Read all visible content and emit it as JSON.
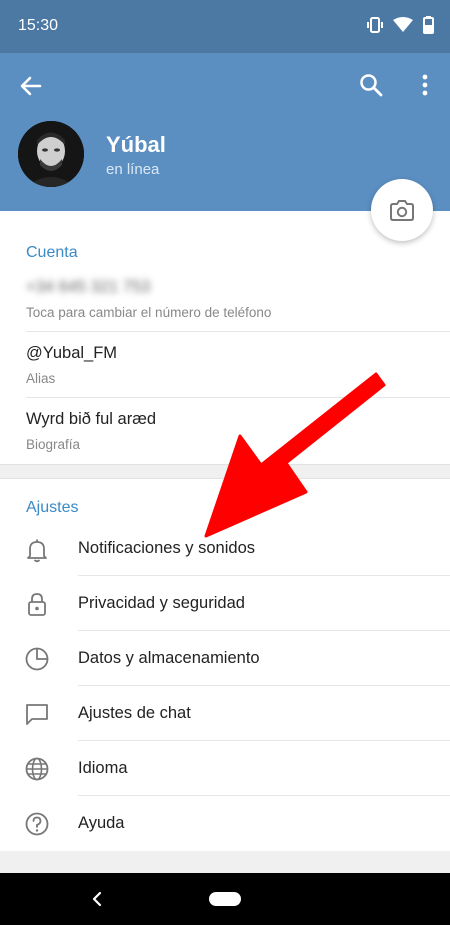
{
  "status_bar": {
    "time": "15:30",
    "icons": [
      "vibrate-icon",
      "wifi-icon",
      "battery-icon"
    ]
  },
  "profile": {
    "name": "Yúbal",
    "status": "en línea"
  },
  "account": {
    "title": "Cuenta",
    "phone": "+34 645 321 753",
    "phone_hint": "Toca para cambiar el número de teléfono",
    "alias": "@Yubal_FM",
    "alias_label": "Alias",
    "bio": "Wyrd bið ful aræd",
    "bio_label": "Biografía"
  },
  "settings": {
    "title": "Ajustes",
    "items": [
      {
        "label": "Notificaciones y sonidos",
        "icon": "bell-icon"
      },
      {
        "label": "Privacidad y seguridad",
        "icon": "lock-icon"
      },
      {
        "label": "Datos y almacenamiento",
        "icon": "pie-chart-icon"
      },
      {
        "label": "Ajustes de chat",
        "icon": "chat-bubble-icon"
      },
      {
        "label": "Idioma",
        "icon": "globe-icon"
      },
      {
        "label": "Ayuda",
        "icon": "help-icon"
      }
    ]
  },
  "colors": {
    "header": "#5b8fc2",
    "status_bar": "#4b79a4",
    "accent": "#3a8ac6",
    "annotation_arrow": "#ff0000"
  }
}
